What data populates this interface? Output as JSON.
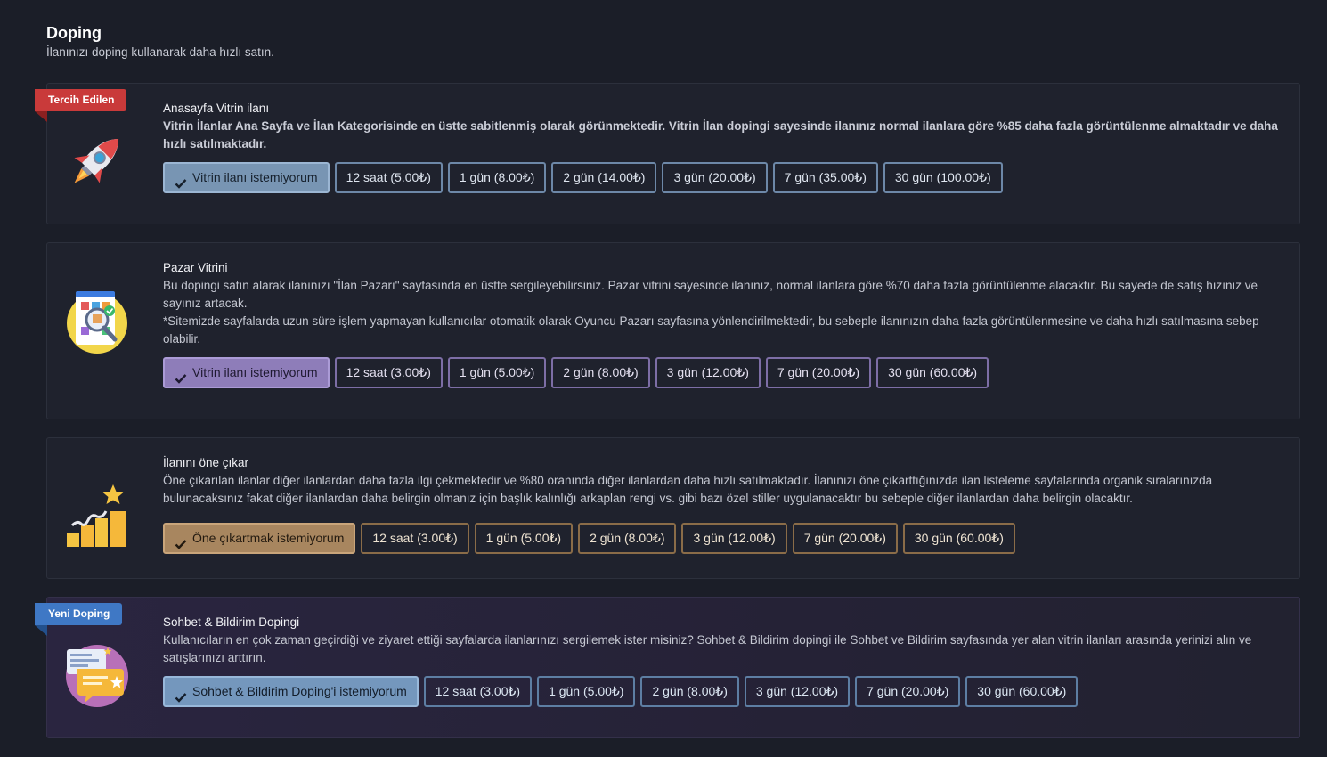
{
  "header": {
    "title": "Doping",
    "subtitle": "İlanınızı doping kullanarak daha hızlı satın."
  },
  "cards": [
    {
      "ribbon": "Tercih Edilen",
      "title": "Anasayfa Vitrin ilanı",
      "desc": "Vitrin İlanlar Ana Sayfa ve İlan Kategorisinde en üstte sabitlenmiş olarak görünmektedir. Vitrin İlan dopingi sayesinde ilanınız normal ilanlara göre %85 daha fazla görüntülenme almaktadır ve daha hızlı satılmaktadır.",
      "options": [
        "Vitrin ilanı istemiyorum",
        "12 saat (5.00₺)",
        "1 gün (8.00₺)",
        "2 gün (14.00₺)",
        "3 gün (20.00₺)",
        "7 gün (35.00₺)",
        "30 gün (100.00₺)"
      ],
      "icon": "rocket-icon"
    },
    {
      "title": "Pazar Vitrini",
      "desc": "Bu dopingi satın alarak ilanınızı \"İlan Pazarı\" sayfasında en üstte sergileyebilirsiniz. Pazar vitrini sayesinde ilanınız, normal ilanlara göre %70 daha fazla görüntülenme alacaktır. Bu sayede de satış hızınız ve sayınız artacak.",
      "desc2": "*Sitemizde sayfalarda uzun süre işlem yapmayan kullanıcılar otomatik olarak Oyuncu Pazarı sayfasına yönlendirilmektedir, bu sebeple ilanınızın daha fazla görüntülenmesine ve daha hızlı satılmasına sebep olabilir.",
      "options": [
        "Vitrin ilanı istemiyorum",
        "12 saat (3.00₺)",
        "1 gün (5.00₺)",
        "2 gün (8.00₺)",
        "3 gün (12.00₺)",
        "7 gün (20.00₺)",
        "30 gün (60.00₺)"
      ],
      "icon": "marketplace-search-icon"
    },
    {
      "title": "İlanını öne çıkar",
      "desc": "Öne çıkarılan ilanlar diğer ilanlardan daha fazla ilgi çekmektedir ve %80 oranında diğer ilanlardan daha hızlı satılmaktadır. İlanınızı öne çıkarttığınızda ilan listeleme sayfalarında organik sıralarınızda bulunacaksınız fakat diğer ilanlardan daha belirgin olmanız için başlık kalınlığı arkaplan rengi vs. gibi bazı özel stiller uygulanacaktır bu sebeple diğer ilanlardan daha belirgin olacaktır.",
      "options": [
        "Öne çıkartmak istemiyorum",
        "12 saat (3.00₺)",
        "1 gün (5.00₺)",
        "2 gün (8.00₺)",
        "3 gün (12.00₺)",
        "7 gün (20.00₺)",
        "30 gün (60.00₺)"
      ],
      "icon": "growth-star-icon"
    },
    {
      "ribbon": "Yeni Doping",
      "title": "Sohbet & Bildirim Dopingi",
      "desc": "Kullanıcıların en çok zaman geçirdiği ve ziyaret ettiği sayfalarda ilanlarınızı sergilemek ister misiniz? Sohbet & Bildirim dopingi ile Sohbet ve Bildirim sayfasında yer alan vitrin ilanları arasında yerinizi alın ve satışlarınızı arttırın.",
      "options": [
        "Sohbet & Bildirim Doping'i istemiyorum",
        "12 saat (3.00₺)",
        "1 gün (5.00₺)",
        "2 gün (8.00₺)",
        "3 gün (12.00₺)",
        "7 gün (20.00₺)",
        "30 gün (60.00₺)"
      ],
      "icon": "chat-notification-icon"
    }
  ],
  "colors": {
    "background": "#1b1e28",
    "vitrin_accent": "#7895b3",
    "pazar_accent": "#8e7db9",
    "one_cikar_accent": "#a8865f",
    "sohbet_accent": "#7497bd",
    "ribbon_red": "#c93a3a",
    "ribbon_blue": "#3f78c5"
  }
}
